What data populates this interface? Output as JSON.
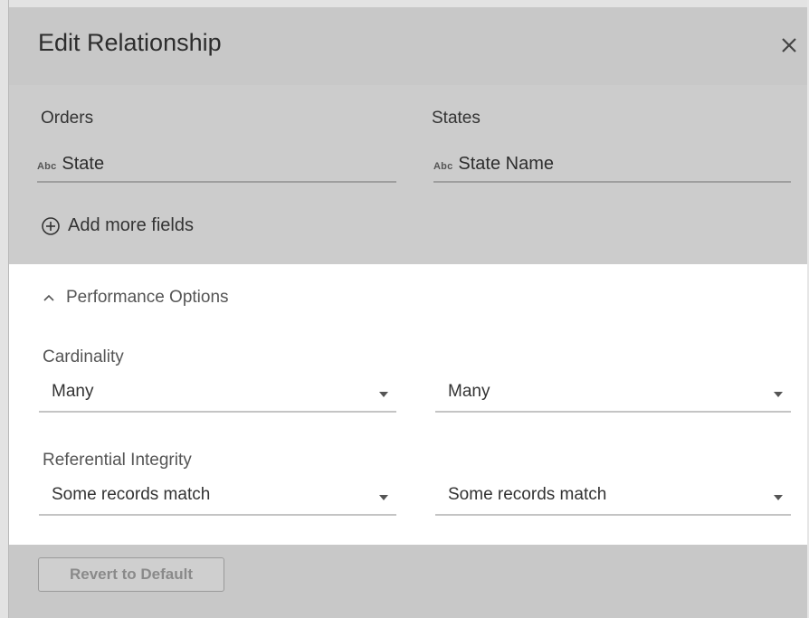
{
  "dialog": {
    "title": "Edit Relationship"
  },
  "relationship": {
    "left_table": "Orders",
    "right_table": "States",
    "left_field": {
      "type_badge": "Abc",
      "name": "State"
    },
    "right_field": {
      "type_badge": "Abc",
      "name": "State Name"
    },
    "add_more_label": "Add more fields"
  },
  "performance": {
    "header": "Performance Options",
    "expanded": true,
    "cardinality": {
      "label": "Cardinality",
      "left_value": "Many",
      "right_value": "Many"
    },
    "referential_integrity": {
      "label": "Referential Integrity",
      "left_value": "Some records match",
      "right_value": "Some records match"
    }
  },
  "footer": {
    "revert_label": "Revert to Default"
  },
  "icons": {
    "close": "close-icon",
    "add": "plus-circle-icon",
    "collapse": "chevron-up-icon",
    "dropdown": "caret-down-icon"
  },
  "colors": {
    "overlay_gray": "#c8c8c8",
    "panel_white": "#ffffff",
    "text_dark": "#2d2d2d",
    "text_muted": "#555555",
    "disabled_text": "#8a8a8a"
  }
}
